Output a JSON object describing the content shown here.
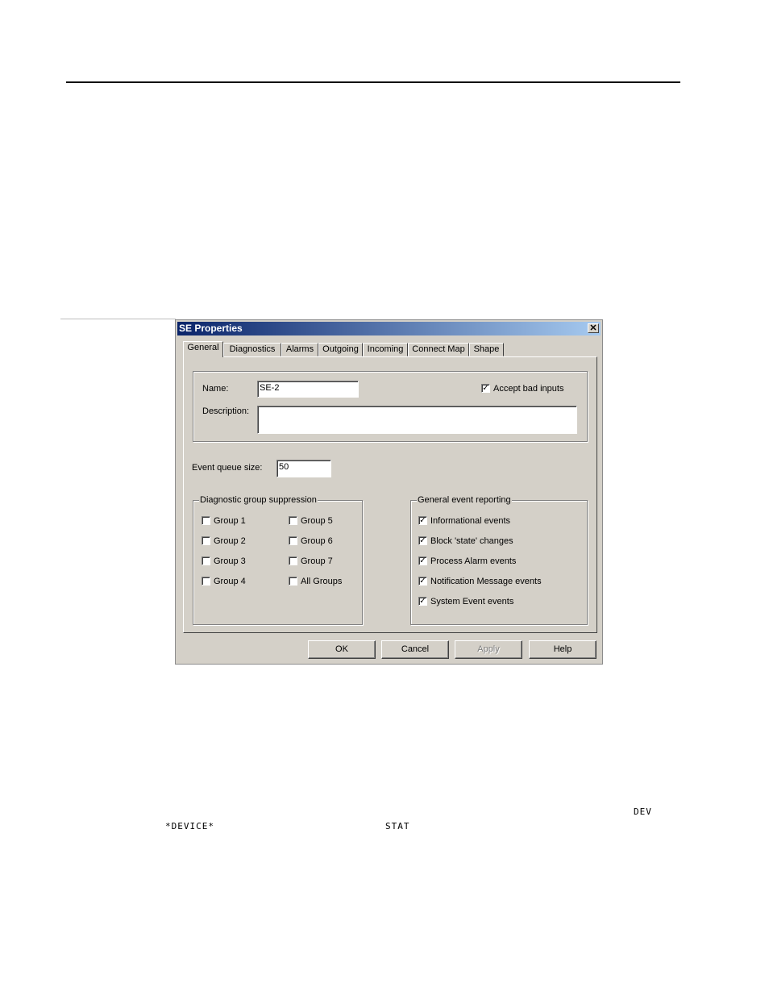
{
  "dialog": {
    "title": "SE Properties",
    "close_glyph": "✕",
    "tabs": [
      {
        "label": "General"
      },
      {
        "label": "Diagnostics"
      },
      {
        "label": "Alarms"
      },
      {
        "label": "Outgoing"
      },
      {
        "label": "Incoming"
      },
      {
        "label": "Connect Map"
      },
      {
        "label": "Shape"
      }
    ],
    "name_label": "Name:",
    "name_value": "SE-2",
    "accept_bad_inputs": {
      "label": "Accept bad inputs",
      "checked": true
    },
    "description_label": "Description:",
    "description_value": "",
    "event_queue_label": "Event queue size:",
    "event_queue_value": "50",
    "diag_group": {
      "title": "Diagnostic group suppression",
      "items": [
        {
          "label": "Group 1",
          "checked": false
        },
        {
          "label": "Group 2",
          "checked": false
        },
        {
          "label": "Group 3",
          "checked": false
        },
        {
          "label": "Group 4",
          "checked": false
        },
        {
          "label": "Group 5",
          "checked": false
        },
        {
          "label": "Group 6",
          "checked": false
        },
        {
          "label": "Group 7",
          "checked": false
        },
        {
          "label": "All Groups",
          "checked": false
        }
      ]
    },
    "event_group": {
      "title": "General event reporting",
      "items": [
        {
          "label": "Informational events",
          "checked": true
        },
        {
          "label": "Block 'state' changes",
          "checked": true
        },
        {
          "label": "Process Alarm events",
          "checked": true
        },
        {
          "label": "Notification Message events",
          "checked": true
        },
        {
          "label": "System Event events",
          "checked": true
        }
      ]
    },
    "buttons": {
      "ok": "OK",
      "cancel": "Cancel",
      "apply": "Apply",
      "help": "Help"
    }
  },
  "page_glyphs": {
    "dev": "DEV",
    "device": "*DEVICE*",
    "stat": "STAT"
  }
}
